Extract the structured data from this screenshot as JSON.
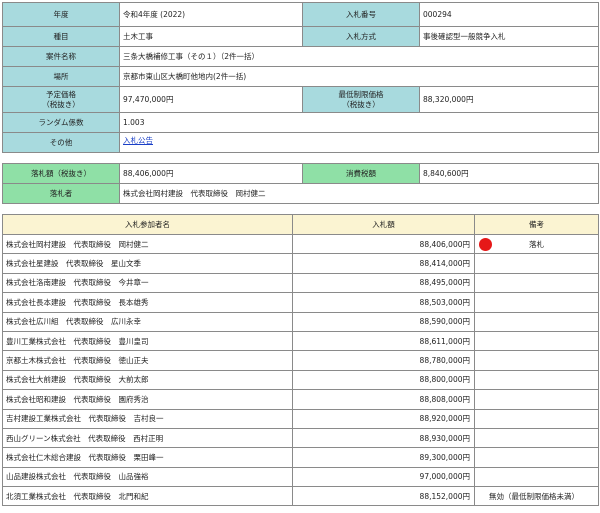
{
  "info": {
    "fiscal_year_label": "年度",
    "fiscal_year": "令和4年度 (2022)",
    "bid_no_label": "入札番号",
    "bid_no": "000294",
    "category_label": "種目",
    "category": "土木工事",
    "method_label": "入札方式",
    "method": "事後確認型一般競争入札",
    "project_label": "案件名称",
    "project": "三条大橋補修工事（その１）（2件一括）",
    "place_label": "場所",
    "place": "京都市東山区大橋町他地内(2件一括)",
    "estimated_label_1": "予定価格",
    "estimated_label_2": "（税抜き）",
    "estimated": "97,470,000円",
    "min_label_1": "最低制限価格",
    "min_label_2": "（税抜き）",
    "min_price": "88,320,000円",
    "random_label": "ランダム係数",
    "random": "1.003",
    "other_label": "その他",
    "other_link": "入札公告"
  },
  "award": {
    "amount_label": "落札額（税抜き）",
    "amount": "88,406,000円",
    "tax_label": "消費税額",
    "tax": "8,840,600円",
    "winner_label": "落札者",
    "winner": "株式会社岡村建設　代表取締役　岡村健二"
  },
  "bids": {
    "headers": [
      "入札参加者名",
      "入札額",
      "備考"
    ],
    "rows": [
      {
        "name": "株式会社岡村建設　代表取締役　岡村健二",
        "amount": "88,406,000円",
        "remark": "落札",
        "winner": true
      },
      {
        "name": "株式会社星建設　代表取締役　星山文季",
        "amount": "88,414,000円",
        "remark": "",
        "winner": false
      },
      {
        "name": "株式会社洛南建設　代表取締役　今井章一",
        "amount": "88,495,000円",
        "remark": "",
        "winner": false
      },
      {
        "name": "株式会社長本建設　代表取締役　長本雄秀",
        "amount": "88,503,000円",
        "remark": "",
        "winner": false
      },
      {
        "name": "株式会社広川組　代表取締役　広川永幸",
        "amount": "88,590,000円",
        "remark": "",
        "winner": false
      },
      {
        "name": "豊川工業株式会社　代表取締役　豊川皇司",
        "amount": "88,611,000円",
        "remark": "",
        "winner": false
      },
      {
        "name": "京都土木株式会社　代表取締役　徳山正夫",
        "amount": "88,780,000円",
        "remark": "",
        "winner": false
      },
      {
        "name": "株式会社大前建設　代表取締役　大前太郎",
        "amount": "88,800,000円",
        "remark": "",
        "winner": false
      },
      {
        "name": "株式会社昭和建設　代表取締役　園府秀治",
        "amount": "88,808,000円",
        "remark": "",
        "winner": false
      },
      {
        "name": "吉村建設工業株式会社　代表取締役　吉村良一",
        "amount": "88,920,000円",
        "remark": "",
        "winner": false
      },
      {
        "name": "西山グリーン株式会社　代表取締役　西村正明",
        "amount": "88,930,000円",
        "remark": "",
        "winner": false
      },
      {
        "name": "株式会社仁木総合建設　代表取締役　栗田峰一",
        "amount": "89,300,000円",
        "remark": "",
        "winner": false
      },
      {
        "name": "山品建設株式会社　代表取締役　山品強裕",
        "amount": "97,000,000円",
        "remark": "",
        "winner": false
      },
      {
        "name": "北須工業株式会社　代表取締役　北門和紀",
        "amount": "88,152,000円",
        "remark": "無効（最低制限価格未満）",
        "winner": false
      }
    ]
  },
  "colors": {
    "label_bg": "#a8dade",
    "award_label_bg": "#8fe0a6",
    "table_header_bg": "#fbf4d2",
    "winner_dot": "#e61818"
  }
}
